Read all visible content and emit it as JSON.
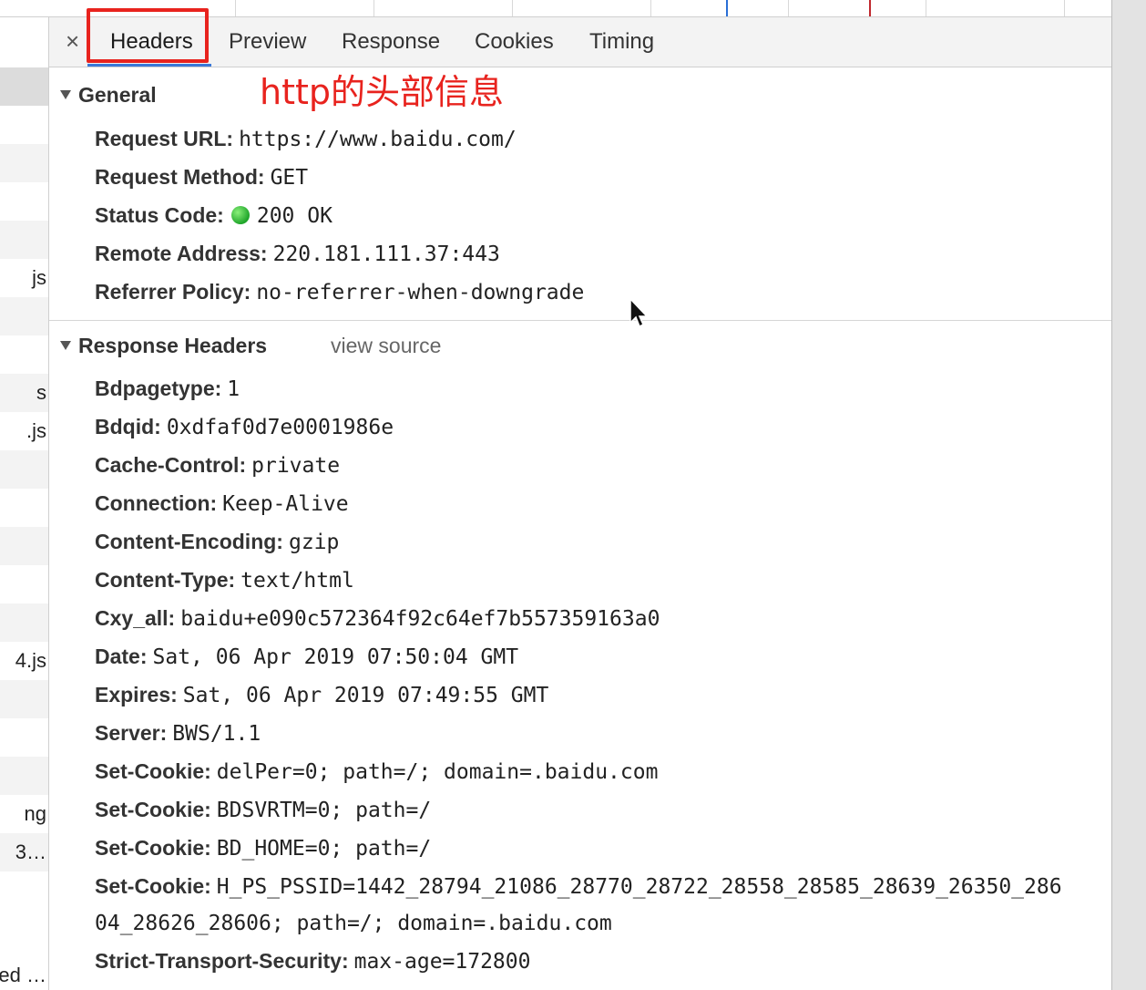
{
  "tabs": [
    "Headers",
    "Preview",
    "Response",
    "Cookies",
    "Timing"
  ],
  "close_label": "×",
  "annotation": "http的头部信息",
  "general": {
    "title": "General",
    "rows": [
      {
        "key": "Request URL:",
        "value": "https://www.baidu.com/"
      },
      {
        "key": "Request Method:",
        "value": "GET"
      },
      {
        "key": "Status Code:",
        "value": "200 OK"
      },
      {
        "key": "Remote Address:",
        "value": "220.181.111.37:443"
      },
      {
        "key": "Referrer Policy:",
        "value": "no-referrer-when-downgrade"
      }
    ]
  },
  "response_headers": {
    "title": "Response Headers",
    "view_source": "view source",
    "rows": [
      {
        "key": "Bdpagetype:",
        "value": "1"
      },
      {
        "key": "Bdqid:",
        "value": "0xdfaf0d7e0001986e"
      },
      {
        "key": "Cache-Control:",
        "value": "private"
      },
      {
        "key": "Connection:",
        "value": "Keep-Alive"
      },
      {
        "key": "Content-Encoding:",
        "value": "gzip"
      },
      {
        "key": "Content-Type:",
        "value": "text/html"
      },
      {
        "key": "Cxy_all:",
        "value": "baidu+e090c572364f92c64ef7b557359163a0"
      },
      {
        "key": "Date:",
        "value": "Sat, 06 Apr 2019 07:50:04 GMT"
      },
      {
        "key": "Expires:",
        "value": "Sat, 06 Apr 2019 07:49:55 GMT"
      },
      {
        "key": "Server:",
        "value": "BWS/1.1"
      },
      {
        "key": "Set-Cookie:",
        "value": "delPer=0; path=/; domain=.baidu.com"
      },
      {
        "key": "Set-Cookie:",
        "value": "BDSVRTM=0; path=/"
      },
      {
        "key": "Set-Cookie:",
        "value": "BD_HOME=0; path=/"
      },
      {
        "key": "Set-Cookie:",
        "value": "H_PS_PSSID=1442_28794_21086_28770_28722_28558_28585_28639_26350_286"
      },
      {
        "key": "",
        "value": "04_28626_28606; path=/; domain=.baidu.com"
      },
      {
        "key": "Strict-Transport-Security:",
        "value": "max-age=172800"
      }
    ]
  },
  "left_list": [
    "js",
    "s",
    ".js",
    "4.js",
    "ng",
    "3…",
    "ed …"
  ],
  "colors": {
    "status_ok": "#1fa52a",
    "annotation_red": "#e8231e",
    "tab_underline": "#3a78d8"
  }
}
